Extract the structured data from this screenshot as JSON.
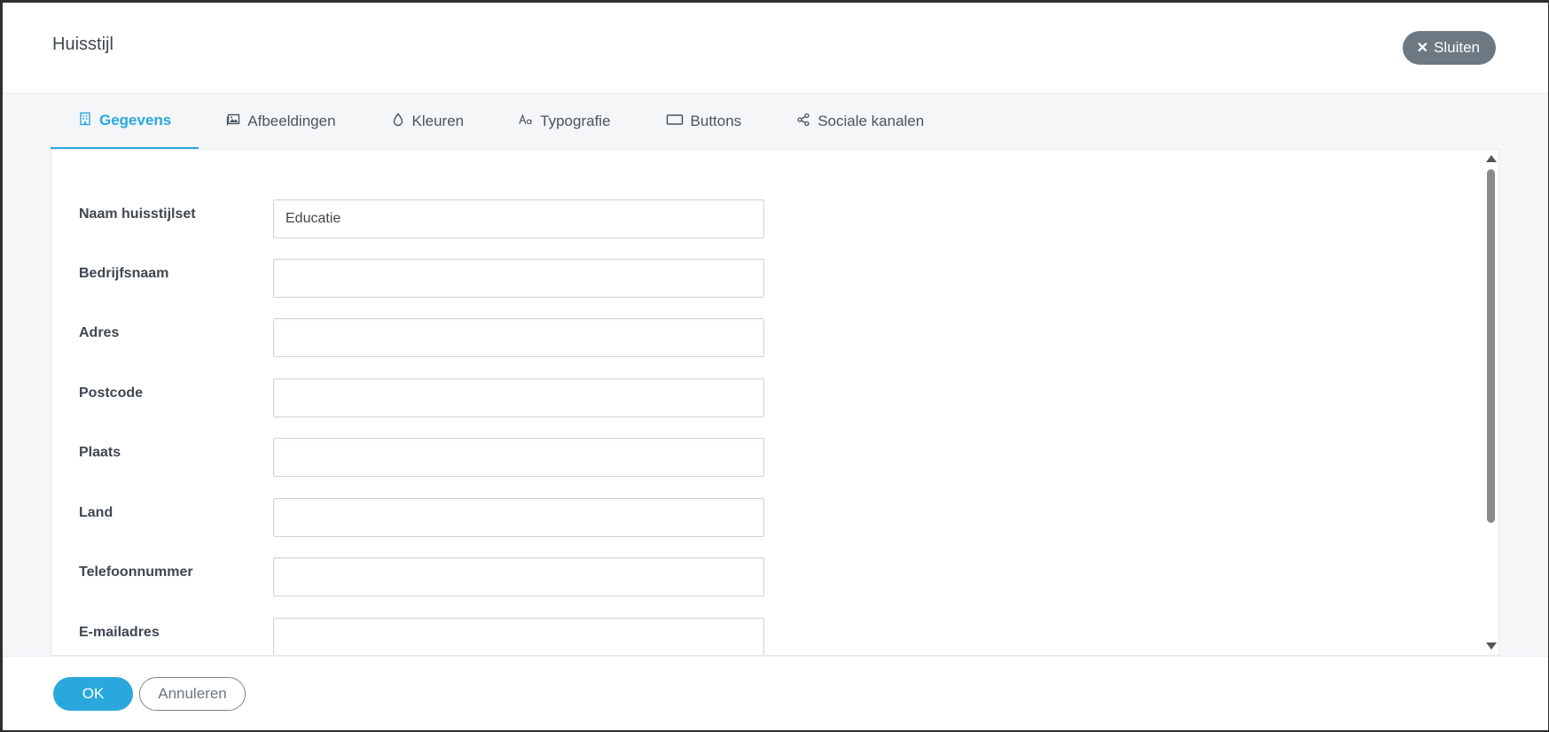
{
  "modal": {
    "title": "Huisstijl",
    "close_label": "Sluiten"
  },
  "tabs": [
    {
      "label": "Gegevens",
      "icon": "building-icon",
      "active": true
    },
    {
      "label": "Afbeeldingen",
      "icon": "image-icon",
      "active": false
    },
    {
      "label": "Kleuren",
      "icon": "droplet-icon",
      "active": false
    },
    {
      "label": "Typografie",
      "icon": "typography-icon",
      "active": false
    },
    {
      "label": "Buttons",
      "icon": "button-rectangle-icon",
      "active": false
    },
    {
      "label": "Sociale kanalen",
      "icon": "share-icon",
      "active": false
    }
  ],
  "form": {
    "fields": [
      {
        "label": "Naam huisstijlset",
        "value": "Educatie"
      },
      {
        "label": "Bedrijfsnaam",
        "value": ""
      },
      {
        "label": "Adres",
        "value": ""
      },
      {
        "label": "Postcode",
        "value": ""
      },
      {
        "label": "Plaats",
        "value": ""
      },
      {
        "label": "Land",
        "value": ""
      },
      {
        "label": "Telefoonnummer",
        "value": ""
      },
      {
        "label": "E-mailadres",
        "value": ""
      }
    ]
  },
  "footer": {
    "ok_label": "OK",
    "cancel_label": "Annuleren"
  },
  "colors": {
    "accent": "#2aa8de",
    "close_button": "#6c7882"
  }
}
